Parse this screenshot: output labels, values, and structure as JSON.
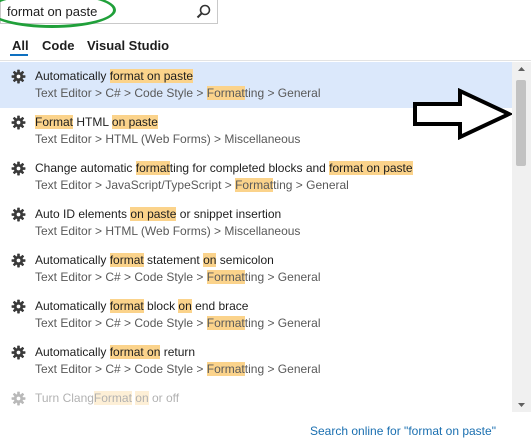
{
  "search": {
    "value": "format on paste"
  },
  "tabs": [
    {
      "label": "All",
      "active": true
    },
    {
      "label": "Code",
      "active": false
    },
    {
      "label": "Visual Studio",
      "active": false
    }
  ],
  "results": [
    {
      "title": [
        [
          "Automatically ",
          false
        ],
        [
          "format on paste",
          true
        ]
      ],
      "path": [
        [
          "Text Editor > C# > Code Style > ",
          false
        ],
        [
          "Format",
          true
        ],
        [
          "ting > General",
          false
        ]
      ],
      "selected": true,
      "faded": false
    },
    {
      "title": [
        [
          "Format",
          true
        ],
        [
          " HTML ",
          false
        ],
        [
          "on paste",
          true
        ]
      ],
      "path": [
        [
          "Text Editor > HTML (Web Forms) > Miscellaneous",
          false
        ]
      ],
      "selected": false,
      "faded": false
    },
    {
      "title": [
        [
          "Change automatic ",
          false
        ],
        [
          "format",
          true
        ],
        [
          "ting for completed blocks and ",
          false
        ],
        [
          "format on paste",
          true
        ]
      ],
      "path": [
        [
          "Text Editor > JavaScript/TypeScript > ",
          false
        ],
        [
          "Format",
          true
        ],
        [
          "ting > General",
          false
        ]
      ],
      "selected": false,
      "faded": false
    },
    {
      "title": [
        [
          "Auto ID elements ",
          false
        ],
        [
          "on paste",
          true
        ],
        [
          " or snippet insertion",
          false
        ]
      ],
      "path": [
        [
          "Text Editor > HTML (Web Forms) > Miscellaneous",
          false
        ]
      ],
      "selected": false,
      "faded": false
    },
    {
      "title": [
        [
          "Automatically ",
          false
        ],
        [
          "format",
          true
        ],
        [
          " statement ",
          false
        ],
        [
          "on",
          true
        ],
        [
          " semicolon",
          false
        ]
      ],
      "path": [
        [
          "Text Editor > C# > Code Style > ",
          false
        ],
        [
          "Format",
          true
        ],
        [
          "ting > General",
          false
        ]
      ],
      "selected": false,
      "faded": false
    },
    {
      "title": [
        [
          "Automatically ",
          false
        ],
        [
          "format",
          true
        ],
        [
          " block ",
          false
        ],
        [
          "on",
          true
        ],
        [
          " end brace",
          false
        ]
      ],
      "path": [
        [
          "Text Editor > C# > Code Style > ",
          false
        ],
        [
          "Format",
          true
        ],
        [
          "ting > General",
          false
        ]
      ],
      "selected": false,
      "faded": false
    },
    {
      "title": [
        [
          "Automatically ",
          false
        ],
        [
          "format on",
          true
        ],
        [
          " return",
          false
        ]
      ],
      "path": [
        [
          "Text Editor > C# > Code Style > ",
          false
        ],
        [
          "Format",
          true
        ],
        [
          "ting > General",
          false
        ]
      ],
      "selected": false,
      "faded": false
    },
    {
      "title": [
        [
          "Turn Clang",
          false
        ],
        [
          "Format",
          true
        ],
        [
          " ",
          false
        ],
        [
          "on",
          true
        ],
        [
          " or off",
          false
        ]
      ],
      "path": [],
      "selected": false,
      "faded": true
    }
  ],
  "footer": {
    "search_online": "Search online for \"format on paste\""
  }
}
